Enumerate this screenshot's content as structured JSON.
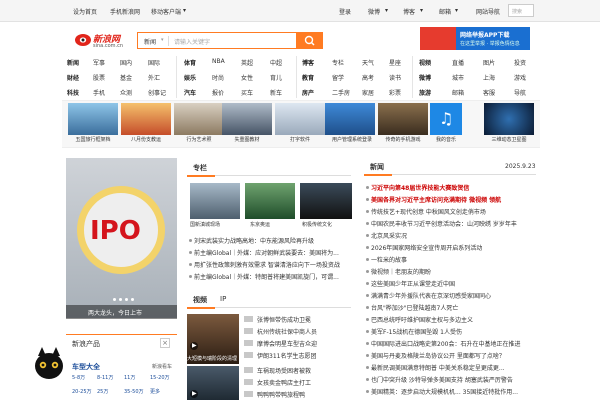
{
  "topbar": {
    "set_home": "设为首页",
    "mobile": "手机新浪网",
    "mobile_client": "移动客户端",
    "login": "登录",
    "weibo": "微博",
    "blog": "博客",
    "mail": "邮箱",
    "nav": "网站导航",
    "search_placeholder": "搜索"
  },
  "header": {
    "logo_text": "新浪网",
    "logo_domain": "sina.com.cn",
    "search_select": "新闻",
    "search_placeholder": "请输入关键字",
    "banner_title": "网络举报APP下载",
    "banner_sub": "在这里举报 · 举报色情信息"
  },
  "nav": {
    "col1": [
      [
        "新闻",
        "军事",
        "国内",
        "国际"
      ],
      [
        "财经",
        "股票",
        "基金",
        "外汇"
      ],
      [
        "科技",
        "手机",
        "众测",
        "创事记"
      ]
    ],
    "col2": [
      [
        "体育",
        "NBA",
        "英超",
        "中超"
      ],
      [
        "娱乐",
        "时尚",
        "女性",
        "育儿"
      ],
      [
        "汽车",
        "报价",
        "买车",
        "新车"
      ]
    ],
    "col3": [
      [
        "博客",
        "专栏",
        "天气",
        "星座"
      ],
      [
        "教育",
        "留学",
        "高考",
        "读书"
      ],
      [
        "房产",
        "二手房",
        "家居",
        "彩票"
      ]
    ],
    "col4": [
      [
        "专题",
        "精品",
        "视频",
        "直播",
        "图片",
        "投资"
      ],
      [
        "公益",
        "微博",
        "城市",
        "上海",
        "游戏"
      ],
      [
        "旅游",
        "邮箱",
        "客服",
        "导航"
      ]
    ]
  },
  "thumbs": [
    "五国旅行框架档",
    "八月份支教运",
    "行为艺术照",
    "失重图教材",
    "打字软件",
    "用户管理系统登录",
    "传奇的手机游戏",
    "我的音乐",
    "三维动态卫星图"
  ],
  "left": {
    "hero_caption": "两大龙头，今日上市",
    "ipo_text": "IPO",
    "products_title": "新浪产品",
    "car_title": "车型大全",
    "car_link": "新浪看车",
    "car_prices": [
      "5-8万",
      "8-11万",
      "11万",
      "15-20万"
    ],
    "car_prices2": [
      "20-25万",
      "25万",
      "35-50万",
      "更多"
    ]
  },
  "middle": {
    "zhuanlan": "专栏",
    "news": [
      "新浪军事观察丨日本方方面面",
      "刘宋武装实力战略高地：中东能源风险再升级",
      "前主编Global｜外媒：应对朝鲜武装要去：美国将为...",
      "用扩张性政策刺激有效需求 智谱清洛应向下一场投资战",
      "前主编Global｜外媒：特朗普将建美国凯旋门，可谓..."
    ],
    "img_caps": [
      "国新滇城现场",
      "东京奥运",
      "积极传统文化"
    ],
    "video_tab": "视频",
    "ip_tab": "IP",
    "video_caption": "大短模与瑞阶段的清理",
    "video_list": [
      "张博恒带伤成功卫冕",
      "杭州传统社保中商人员",
      "摩博会明星车型吉众迎",
      "伊朗311名学生志愿团",
      "车祸现场受困者被救",
      "女孩卖金鸭店主打工",
      "鸭鸭鸭带鸭旅程鸭"
    ]
  },
  "right": {
    "title": "新闻",
    "date": "2025.9.23",
    "items": [
      {
        "text": "习近平向第48届世界技能大赛致贺信",
        "red": true
      },
      {
        "text": "美国各界对习近平主席访问充满期待 微视频 领航",
        "red": true
      },
      {
        "text": "传统技艺+现代创意 中秋国风文创走俏市场",
        "red": false
      },
      {
        "text": "中国农民丰收节习近平创意活动会：山河映绣 岁岁年丰",
        "red": false
      },
      {
        "text": "北京风采实况",
        "red": false
      },
      {
        "text": "2026年国家网络安全宣传周开启系列活动",
        "red": false
      },
      {
        "text": "一粒米的故事",
        "red": false
      },
      {
        "text": "微视频｜老朋友的期盼",
        "red": false
      },
      {
        "text": "这些美国少年正从课堂走近中国",
        "red": false
      },
      {
        "text": "满满青少年外援队代表在京深切感受家国同心",
        "red": false
      },
      {
        "text": "台风\"桦加沙\"已登陆越南7人死亡",
        "red": false
      },
      {
        "text": "巴西总统呼吁维护国家主权与多边主义",
        "red": false
      },
      {
        "text": "美军F-15战机在德国坠毁 1人受伤",
        "red": false
      },
      {
        "text": "中国国际进出口战略史第200会：石升在中基地正在推进",
        "red": false
      },
      {
        "text": "美国与丹麦及格陵兰岛协议公开 里面都写了点啥？",
        "red": false
      },
      {
        "text": "最新民调美国满意特朗普 中美关系稳定呈更成更...",
        "red": false
      },
      {
        "text": "也门中突升级 沙特导弹多美国支持 胡塞武装严厉警告",
        "red": false
      },
      {
        "text": "美国精英：逐步启动大规模机机... 35国接近特批作用...",
        "red": false
      }
    ]
  },
  "colors": {
    "brand_red": "#e1251b",
    "search_orange": "#ff7b22",
    "link_red": "#c00000"
  }
}
